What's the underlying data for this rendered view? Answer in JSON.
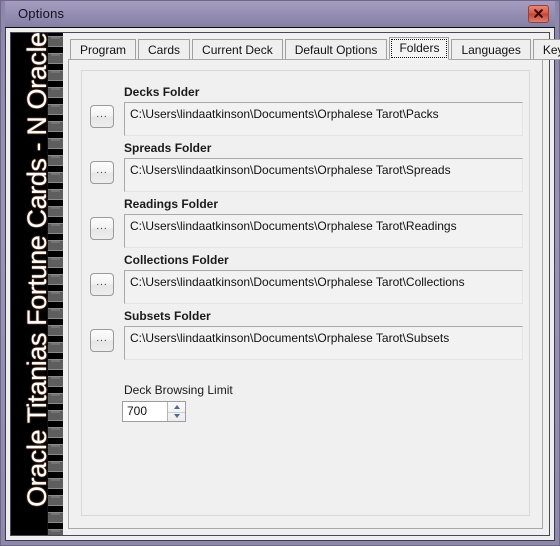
{
  "window": {
    "title": "Options",
    "close_label": "close-icon",
    "accent_titlebar": "#9a93b7",
    "close_color": "#d8584a"
  },
  "banner": {
    "text": "Oracle Titanias Fortune Cards - N Oracle"
  },
  "tabs": [
    {
      "label": "Program",
      "selected": false
    },
    {
      "label": "Cards",
      "selected": false
    },
    {
      "label": "Current Deck",
      "selected": false
    },
    {
      "label": "Default Options",
      "selected": false
    },
    {
      "label": "Folders",
      "selected": true
    },
    {
      "label": "Languages",
      "selected": false
    },
    {
      "label": "Keys",
      "selected": false
    }
  ],
  "folders": [
    {
      "label": "Decks Folder",
      "path": "C:\\Users\\lindaatkinson\\Documents\\Orphalese Tarot\\Packs",
      "browse_label": "..."
    },
    {
      "label": "Spreads Folder",
      "path": "C:\\Users\\lindaatkinson\\Documents\\Orphalese Tarot\\Spreads",
      "browse_label": "..."
    },
    {
      "label": "Readings Folder",
      "path": "C:\\Users\\lindaatkinson\\Documents\\Orphalese Tarot\\Readings",
      "browse_label": "..."
    },
    {
      "label": "Collections Folder",
      "path": "C:\\Users\\lindaatkinson\\Documents\\Orphalese Tarot\\Collections",
      "browse_label": "..."
    },
    {
      "label": "Subsets Folder",
      "path": "C:\\Users\\lindaatkinson\\Documents\\Orphalese Tarot\\Subsets",
      "browse_label": "..."
    }
  ],
  "deck_browsing_limit": {
    "label": "Deck Browsing Limit",
    "value": "700"
  }
}
